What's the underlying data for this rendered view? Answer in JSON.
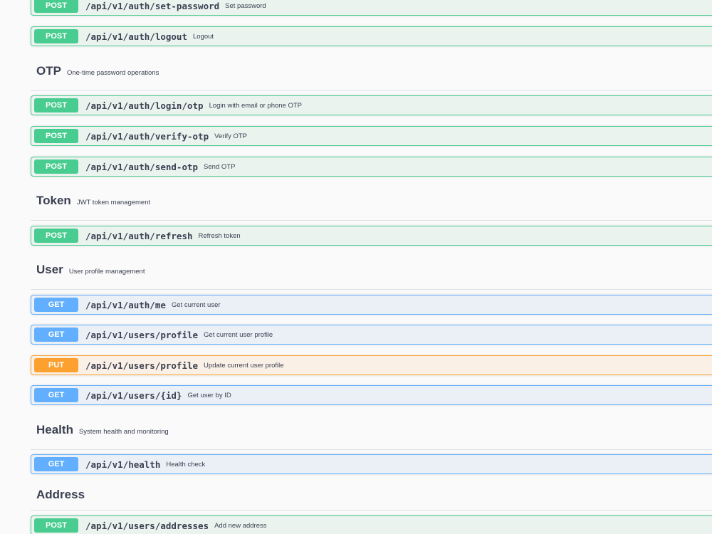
{
  "auth": {
    "ops": [
      {
        "method": "POST",
        "path": "/api/v1/auth/set-password",
        "summary": "Set password"
      },
      {
        "method": "POST",
        "path": "/api/v1/auth/logout",
        "summary": "Logout"
      }
    ]
  },
  "otp": {
    "name": "OTP",
    "description": "One-time password operations",
    "ops": [
      {
        "method": "POST",
        "path": "/api/v1/auth/login/otp",
        "summary": "Login with email or phone OTP"
      },
      {
        "method": "POST",
        "path": "/api/v1/auth/verify-otp",
        "summary": "Verify OTP"
      },
      {
        "method": "POST",
        "path": "/api/v1/auth/send-otp",
        "summary": "Send OTP"
      }
    ]
  },
  "token": {
    "name": "Token",
    "description": "JWT token management",
    "ops": [
      {
        "method": "POST",
        "path": "/api/v1/auth/refresh",
        "summary": "Refresh token"
      }
    ]
  },
  "user": {
    "name": "User",
    "description": "User profile management",
    "ops": [
      {
        "method": "GET",
        "path": "/api/v1/auth/me",
        "summary": "Get current user"
      },
      {
        "method": "GET",
        "path": "/api/v1/users/profile",
        "summary": "Get current user profile"
      },
      {
        "method": "PUT",
        "path": "/api/v1/users/profile",
        "summary": "Update current user profile"
      },
      {
        "method": "GET",
        "path": "/api/v1/users/{id}",
        "summary": "Get user by ID"
      }
    ]
  },
  "health": {
    "name": "Health",
    "description": "System health and monitoring",
    "ops": [
      {
        "method": "GET",
        "path": "/api/v1/health",
        "summary": "Health check"
      }
    ]
  },
  "address": {
    "name": "Address",
    "description": "",
    "ops": [
      {
        "method": "POST",
        "path": "/api/v1/users/addresses",
        "summary": "Add new address"
      }
    ]
  },
  "colors": {
    "post": "#49cc90",
    "get": "#61affe",
    "put": "#fca130",
    "text": "#3b4151"
  }
}
